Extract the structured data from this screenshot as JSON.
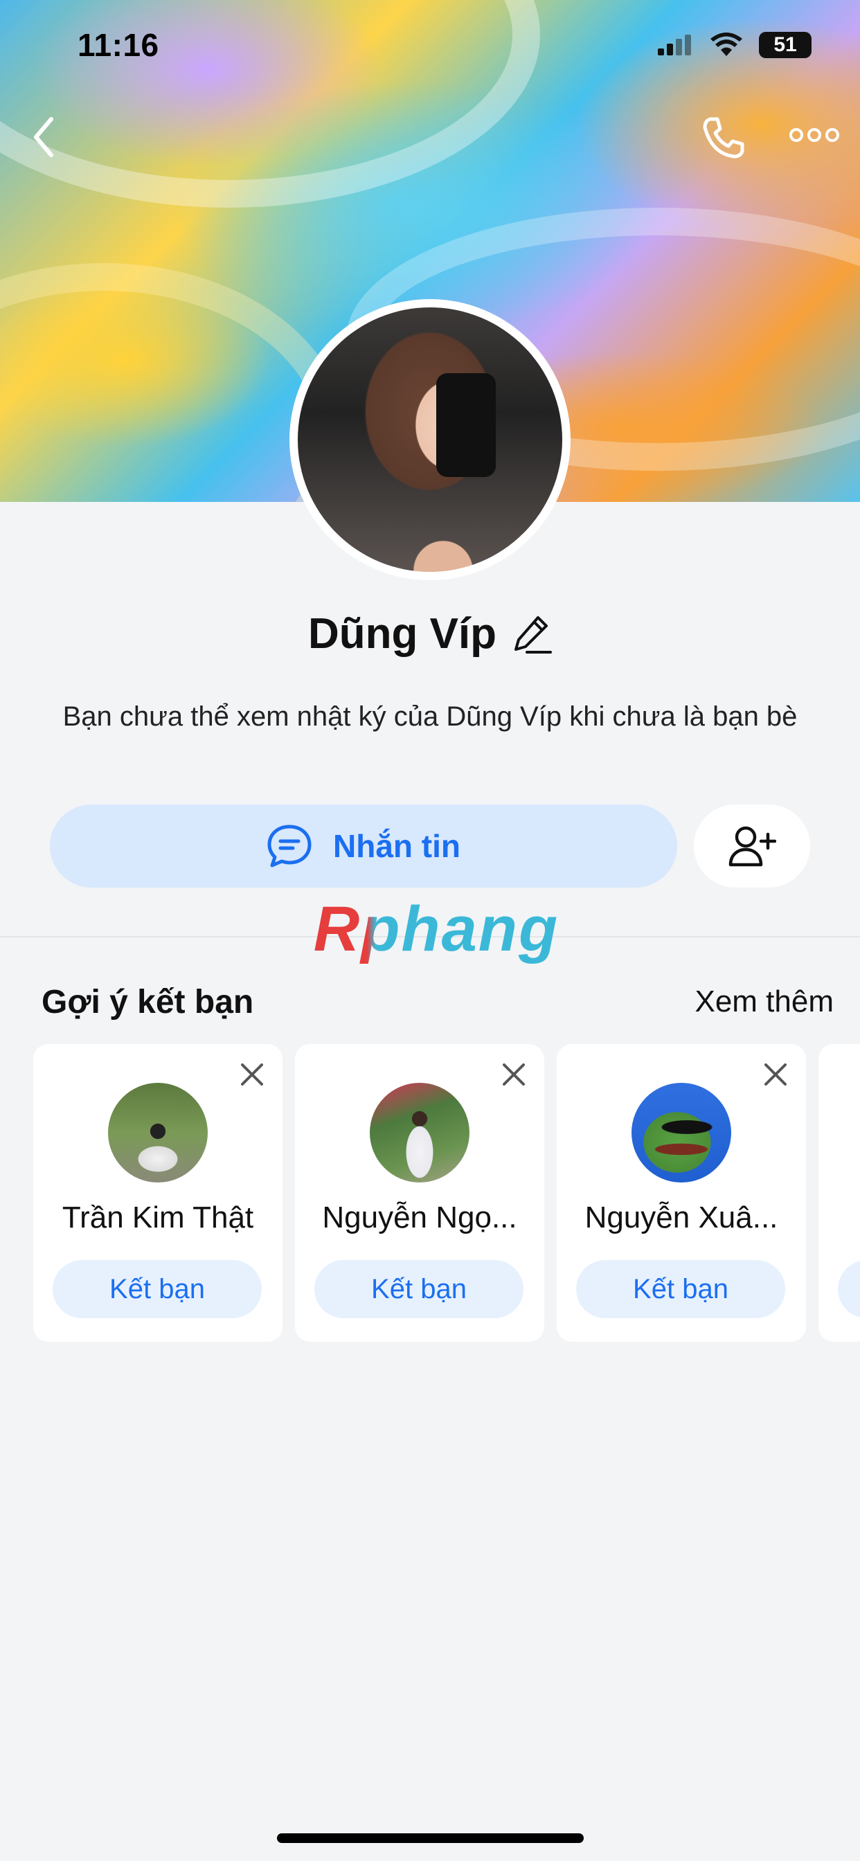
{
  "status_bar": {
    "time": "11:16",
    "battery": "51"
  },
  "header": {
    "back_icon": "chevron-left-icon",
    "call_icon": "phone-icon",
    "more_icon": "more-dots-icon"
  },
  "profile": {
    "name": "Dũng Víp",
    "description": "Bạn chưa thể xem nhật ký của Dũng Víp khi chưa là bạn bè",
    "message_button": "Nhắn tin"
  },
  "watermark": "Rphang",
  "suggestions": {
    "title": "Gợi ý kết bạn",
    "see_more": "Xem thêm",
    "cards": [
      {
        "name": "Trần Kim Thật",
        "button": "Kết bạn"
      },
      {
        "name": "Nguyễn Ngọ...",
        "button": "Kết bạn"
      },
      {
        "name": "Nguyễn Xuâ...",
        "button": "Kết bạn"
      }
    ]
  }
}
